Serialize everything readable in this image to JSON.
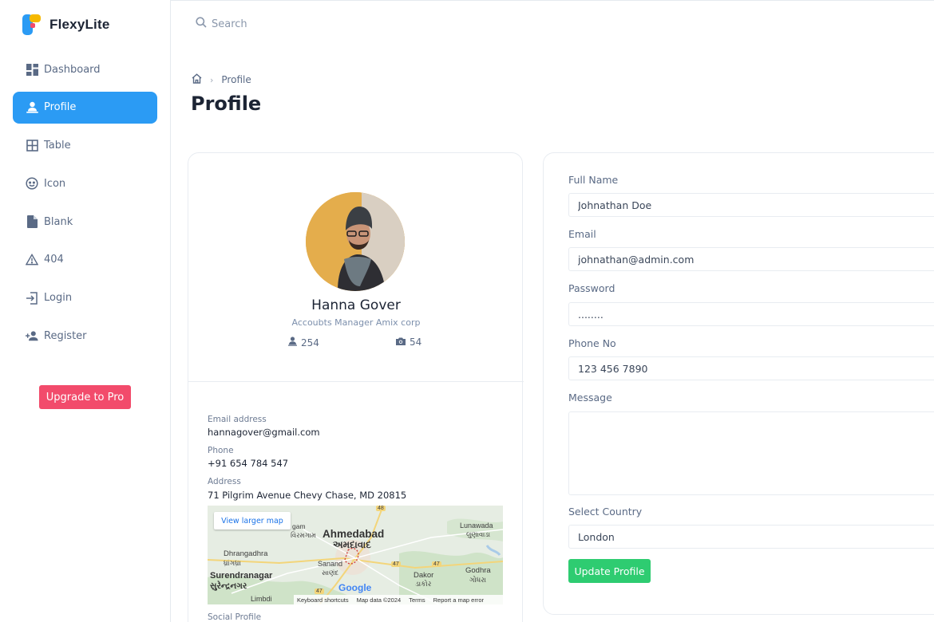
{
  "brand": {
    "name": "FlexyLite"
  },
  "sidebar": {
    "items": [
      {
        "label": "Dashboard",
        "icon": "dashboard-icon",
        "active": false
      },
      {
        "label": "Profile",
        "icon": "user-icon",
        "active": true
      },
      {
        "label": "Table",
        "icon": "table-icon",
        "active": false
      },
      {
        "label": "Icon",
        "icon": "smile-icon",
        "active": false
      },
      {
        "label": "Blank",
        "icon": "file-icon",
        "active": false
      },
      {
        "label": "404",
        "icon": "warning-icon",
        "active": false
      },
      {
        "label": "Login",
        "icon": "login-icon",
        "active": false
      },
      {
        "label": "Register",
        "icon": "user-plus-icon",
        "active": false
      }
    ],
    "upgrade_label": "Upgrade to Pro"
  },
  "header": {
    "search_placeholder": "Search"
  },
  "breadcrumb": {
    "current": "Profile"
  },
  "page": {
    "title": "Profile"
  },
  "profile": {
    "name": "Hanna Gover",
    "role": "Accoubts Manager Amix corp",
    "followers": "254",
    "photos": "54",
    "email_label": "Email address",
    "email": "hannagover@gmail.com",
    "phone_label": "Phone",
    "phone": "+91 654 784 547",
    "address_label": "Address",
    "address": "71 Pilgrim Avenue Chevy Chase, MD 20815",
    "social_label": "Social Profile"
  },
  "map": {
    "view_larger": "View larger map",
    "labels": {
      "ahmedabad": "Ahmedabad",
      "ahmedabad_gu": "અમદાવાદ",
      "dhrangadhra": "Dhrangadhra",
      "dhrangadhra_gu": "ધ્રાંગધ્રા",
      "surendranagar": "Surendranagar",
      "surendranagar_gu": "સુરેન્દ્રનગર",
      "sanand": "Sanand",
      "sanand_gu": "સાણંદ",
      "lunawada": "Lunawada",
      "lunawada_gu": "લુણાવાડા",
      "godhra": "Godhra",
      "godhra_gu": "ગોધરા",
      "dakor": "Dakor",
      "dakor_gu": "ડાકોર",
      "limbdi": "Limbdi",
      "viramgam_partial": "gam",
      "viramgam_gu_partial": "વિરમગામ"
    },
    "road_48": "48",
    "road_47": "47",
    "google": "Google",
    "footer": {
      "shortcuts": "Keyboard shortcuts",
      "data": "Map data ©2024",
      "terms": "Terms",
      "report": "Report a map error"
    }
  },
  "form": {
    "full_name_label": "Full Name",
    "full_name": "Johnathan Doe",
    "email_label": "Email",
    "email": "johnathan@admin.com",
    "password_label": "Password",
    "password": "........",
    "phone_label": "Phone No",
    "phone": "123 456 7890",
    "message_label": "Message",
    "country_label": "Select Country",
    "country": "London",
    "submit_label": "Update Profile"
  },
  "colors": {
    "primary": "#2b9bf4",
    "upgrade": "#f24b6b",
    "success": "#2ecc71",
    "text_dark": "#1c2434",
    "text_muted": "#5a6a85"
  }
}
